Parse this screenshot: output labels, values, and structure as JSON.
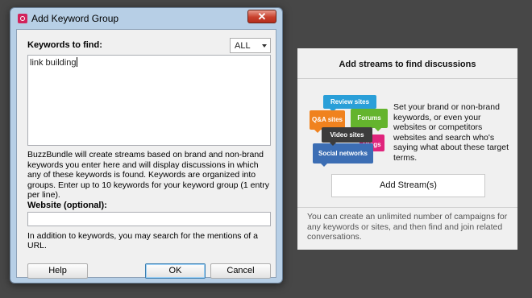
{
  "dialog": {
    "title": "Add Keyword Group",
    "close_glyph": "✕",
    "keywords_label": "Keywords to find:",
    "filter_select": {
      "selected": "ALL"
    },
    "keywords_value": "link building",
    "description": "BuzzBundle will create streams based on brand and non-brand keywords you enter here and will display discussions in which any of these keywords is found. Keywords are organized into groups. Enter up to 10 keywords for your keyword group (1 entry per line).",
    "website_label": "Website (optional):",
    "website_value": "",
    "website_hint": "In addition to keywords, you may search for the mentions of a URL.",
    "buttons": {
      "help": "Help",
      "ok": "OK",
      "cancel": "Cancel"
    }
  },
  "panel": {
    "title": "Add streams to find discussions",
    "bubbles": {
      "review": "Review sites",
      "qa": "Q&A sites",
      "forums": "Forums",
      "video": "Video sites",
      "blogs": "Blogs",
      "social": "Social networks"
    },
    "description": "Set your brand or non-brand keywords, or even your websites or competitors websites and search who's saying what about these target terms.",
    "add_button": "Add Stream(s)",
    "note": "You can create an unlimited number of campaigns for any keywords or sites, and then find and join related conversations."
  },
  "colors": {
    "background": "#474747",
    "dialog_frame": "#b7cfe6",
    "review": "#2a9fd8",
    "qa": "#f0821e",
    "forums": "#64b42d",
    "video": "#3c3c3c",
    "blogs": "#e0247c",
    "social": "#3c6eb4"
  }
}
